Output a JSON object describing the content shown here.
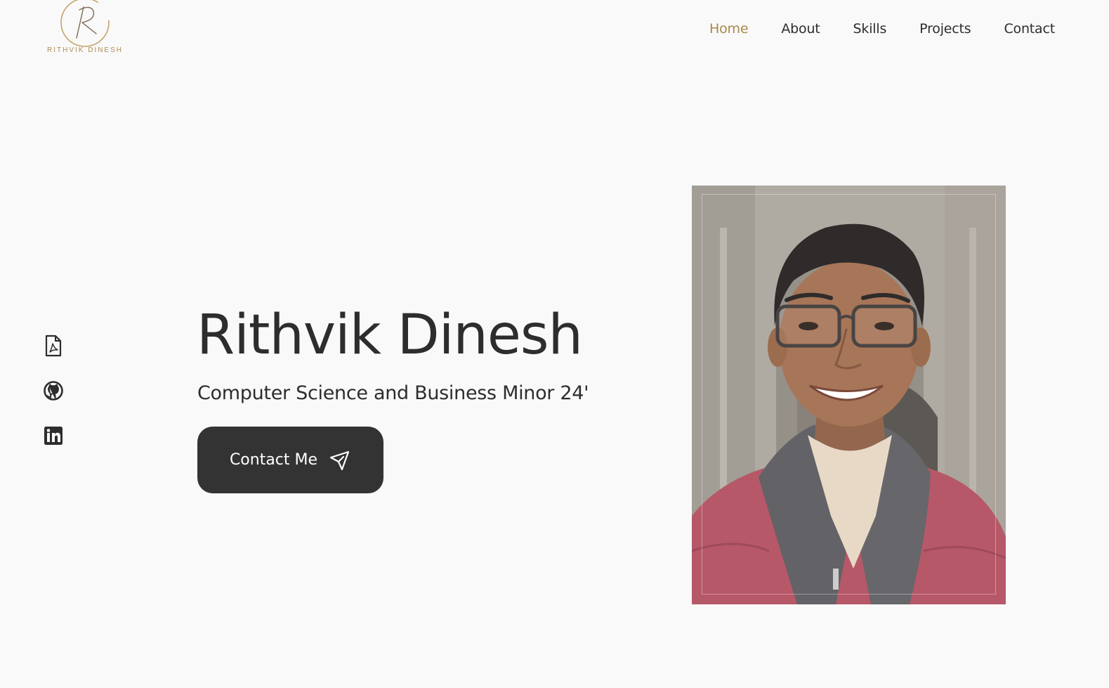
{
  "header": {
    "logo_monogram": "R",
    "logo_text": "RITHVIK DINESH",
    "nav": [
      {
        "label": "Home",
        "active": true
      },
      {
        "label": "About",
        "active": false
      },
      {
        "label": "Skills",
        "active": false
      },
      {
        "label": "Projects",
        "active": false
      },
      {
        "label": "Contact",
        "active": false
      }
    ]
  },
  "social": [
    {
      "icon": "pdf-file-icon"
    },
    {
      "icon": "github-icon"
    },
    {
      "icon": "linkedin-icon"
    }
  ],
  "hero": {
    "title": "Rithvik Dinesh",
    "subtitle": "Computer Science and Business Minor 24'",
    "button_label": "Contact Me",
    "button_icon": "send-icon"
  },
  "photo": {
    "subject": "profile-photo"
  },
  "colors": {
    "accent": "#a88a4a",
    "text": "#2d2d2d",
    "button_bg": "#333333",
    "background": "#f9f9f9"
  }
}
